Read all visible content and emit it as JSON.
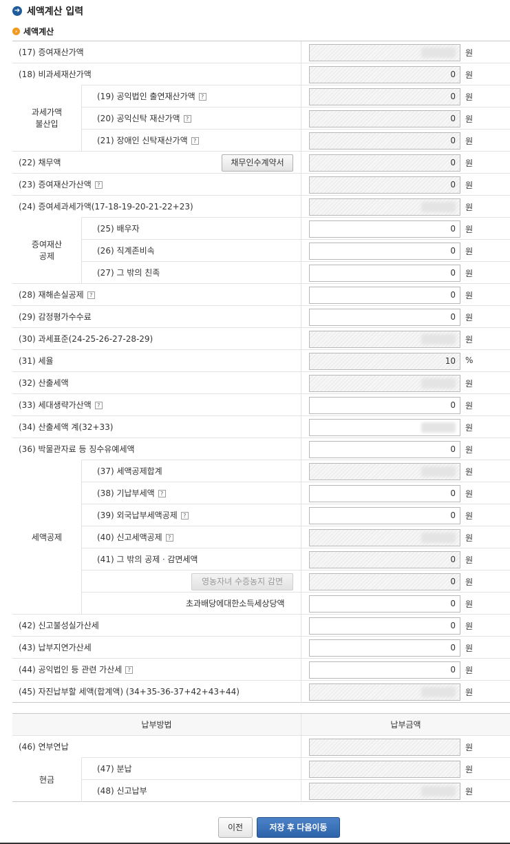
{
  "header": {
    "title": "세액계산 입력",
    "section": "세액계산"
  },
  "unit_won": "원",
  "unit_percent": "%",
  "help_mark": "?",
  "groups": {
    "taxable_excluded": "과세가액\n불산입",
    "gift_deduction": "증여재산\n공제",
    "tax_credit": "세액공제",
    "cash": "현금"
  },
  "rows": [
    {
      "label": "(17) 증여재산가액",
      "value": "",
      "blurred": true,
      "readonly": true
    },
    {
      "label": "(18) 비과세재산가액",
      "value": "0",
      "readonly": true
    },
    {
      "label": "(19) 공익법인 출연재산가액",
      "value": "0",
      "readonly": true,
      "help": true
    },
    {
      "label": "(20) 공익신탁 재산가액",
      "value": "0",
      "readonly": true,
      "help": true
    },
    {
      "label": "(21) 장애인 신탁재산가액",
      "value": "0",
      "readonly": true,
      "help": true
    },
    {
      "label": "(22) 채무액",
      "value": "0",
      "readonly": true,
      "button": "채무인수계약서"
    },
    {
      "label": "(23) 증여재산가산액",
      "value": "0",
      "readonly": true,
      "help": true
    },
    {
      "label": "(24) 증여세과세가액(17-18-19-20-21-22+23)",
      "value": "",
      "blurred": true,
      "readonly": true
    },
    {
      "label": "(25) 배우자",
      "value": "0",
      "readonly": false
    },
    {
      "label": "(26) 직계존비속",
      "value": "0",
      "readonly": false
    },
    {
      "label": "(27) 그 밖의 친족",
      "value": "0",
      "readonly": false
    },
    {
      "label": "(28) 재해손실공제",
      "value": "0",
      "readonly": false,
      "help": true
    },
    {
      "label": "(29) 감정평가수수료",
      "value": "0",
      "readonly": false
    },
    {
      "label": "(30) 과세표준(24-25-26-27-28-29)",
      "value": "",
      "blurred": true,
      "readonly": true
    },
    {
      "label": "(31) 세율",
      "value": "10",
      "readonly": true,
      "unit": "%"
    },
    {
      "label": "(32) 산출세액",
      "value": "",
      "blurred": true,
      "readonly": true
    },
    {
      "label": "(33) 세대생략가산액",
      "value": "0",
      "readonly": false,
      "help": true
    },
    {
      "label": "(34) 산출세액 계(32+33)",
      "value": "",
      "blurred": true,
      "readonly": false
    },
    {
      "label": "(36) 박물관자료 등 징수유예세액",
      "value": "0",
      "readonly": false
    },
    {
      "label": "(37) 세액공제합계",
      "value": "",
      "blurred": true,
      "readonly": true
    },
    {
      "label": "(38) 기납부세액",
      "value": "0",
      "readonly": false,
      "help": true
    },
    {
      "label": "(39) 외국납부세액공제",
      "value": "0",
      "readonly": false,
      "help": true
    },
    {
      "label": "(40) 신고세액공제",
      "value": "",
      "blurred": true,
      "readonly": true,
      "help": true
    },
    {
      "label": "(41) 그 밖의 공제ㆍ감면세액",
      "value": "0",
      "readonly": true
    },
    {
      "label": "",
      "value": "0",
      "readonly": true,
      "button": "영농자녀 수증농지 감면",
      "button_disabled": true
    },
    {
      "label": "초과배당에대한소득세상당액",
      "value": "0",
      "readonly": false
    },
    {
      "label": "(42) 신고불성실가산세",
      "value": "0",
      "readonly": false
    },
    {
      "label": "(43) 납부지연가산세",
      "value": "0",
      "readonly": false
    },
    {
      "label": "(44) 공익법인 등 관련 가산세",
      "value": "0",
      "readonly": false,
      "help": true
    },
    {
      "label": "(45) 자진납부할 세액(합계액) (34+35-36-37+42+43+44)",
      "value": "",
      "blurred": true,
      "readonly": true
    }
  ],
  "payment": {
    "col_method": "납부방법",
    "col_amount": "납부금액",
    "rows": [
      {
        "label": "(46) 연부연납",
        "value": "",
        "readonly": true
      },
      {
        "label": "(47) 분납",
        "value": "",
        "readonly": true
      },
      {
        "label": "(48) 신고납부",
        "value": "",
        "blurred": true,
        "readonly": true
      }
    ]
  },
  "buttons": {
    "prev": "이전",
    "next": "저장 후 다음이동"
  }
}
